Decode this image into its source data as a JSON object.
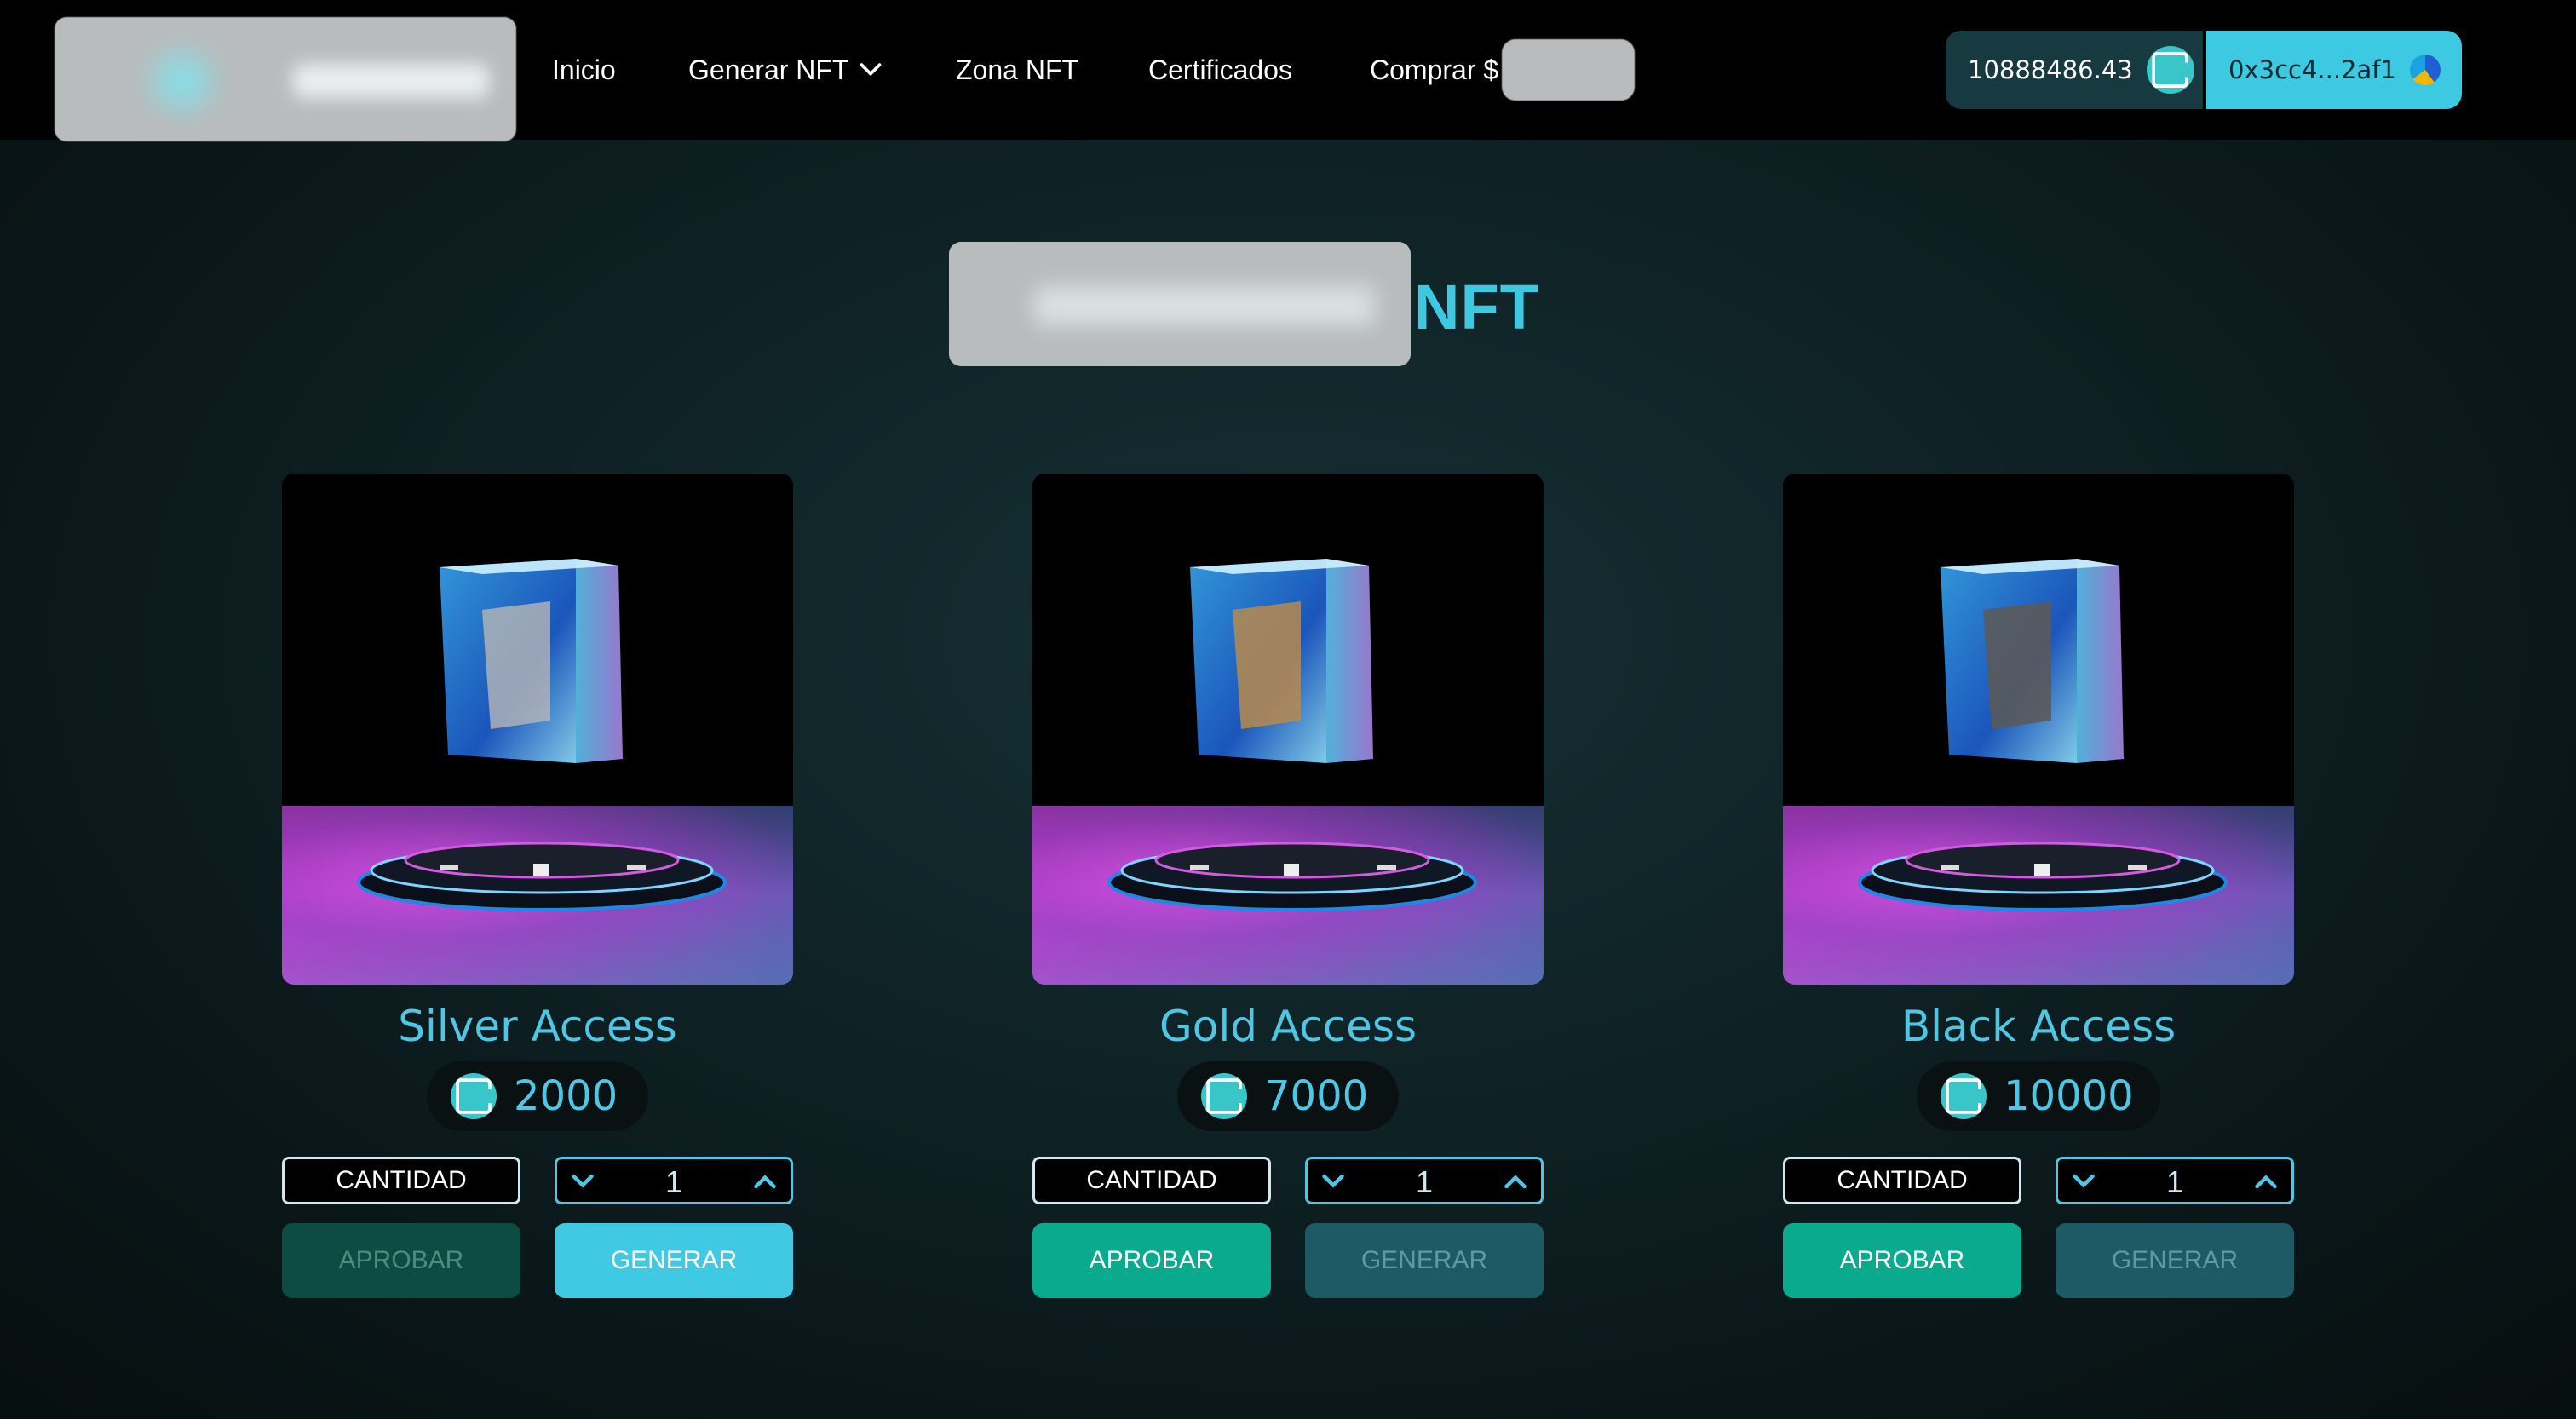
{
  "nav": {
    "items": [
      "Inicio",
      "Generar NFT",
      "Zona NFT",
      "Certificados",
      "Comprar $"
    ]
  },
  "wallet": {
    "balance": "10888486.43",
    "address": "0x3cc4...2af1"
  },
  "page": {
    "title_suffix": "NFT"
  },
  "cards": [
    {
      "name": "Silver Access",
      "price": "2000",
      "quantity_label": "CANTIDAD",
      "quantity": "1",
      "approve_label": "APROBAR",
      "generate_label": "GENERAR",
      "approve_state": "disabled",
      "generate_state": "enabled",
      "slab_color": "#b7b7b7"
    },
    {
      "name": "Gold Access",
      "price": "7000",
      "quantity_label": "CANTIDAD",
      "quantity": "1",
      "approve_label": "APROBAR",
      "generate_label": "GENERAR",
      "approve_state": "enabled",
      "generate_state": "disabled",
      "slab_color": "#b88a4e"
    },
    {
      "name": "Black Access",
      "price": "10000",
      "quantity_label": "CANTIDAD",
      "quantity": "1",
      "approve_label": "APROBAR",
      "generate_label": "GENERAR",
      "approve_state": "enabled",
      "generate_state": "disabled",
      "slab_color": "#5a5a5a"
    }
  ],
  "colors": {
    "accent": "#3cc9e1",
    "approve_enabled": "#0aaa8e",
    "generate_enabled": "#40c9e2"
  }
}
